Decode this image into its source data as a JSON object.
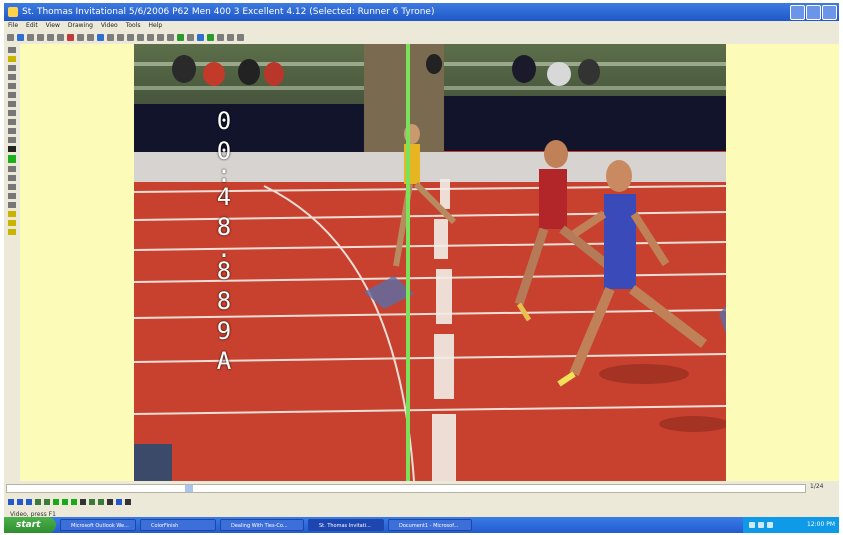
{
  "window": {
    "title": "St. Thomas Invitational  5/6/2006  P62  Men  400  3  Excellent  4.12  (Selected: Runner 6 Tyrone)"
  },
  "menu": [
    "File",
    "Edit",
    "View",
    "Drawing",
    "Video",
    "Tools",
    "Help"
  ],
  "timer": {
    "digits": [
      "0",
      "0",
      ":",
      "4",
      "8",
      ".",
      "8",
      "8",
      "9",
      "A"
    ]
  },
  "playback": {
    "frame_count": "1/24",
    "status": "Video, press F1"
  },
  "taskbar": {
    "start_label": "start",
    "items": [
      "Microsoft Outlook We...",
      "ColorFinish",
      "Dealing With Ties-Co...",
      "St. Thomas Invitati...",
      "Document1 - Microsof..."
    ],
    "clock": "12:00 PM"
  },
  "colors": {
    "track": "#c8412e",
    "finish_line": "#7be05a",
    "panel_yellow": "#fdfbb8",
    "timer_text": "#ffffff"
  }
}
